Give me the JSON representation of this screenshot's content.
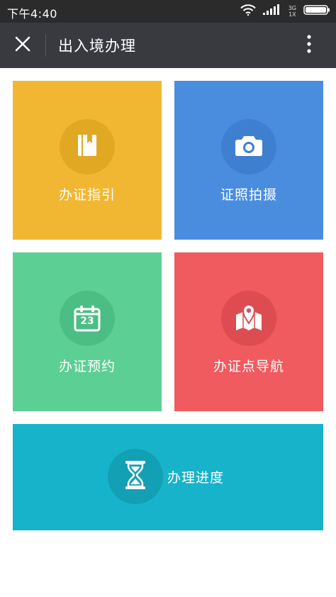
{
  "status_bar": {
    "time": "下午4:40",
    "network_top": "3G",
    "network_bottom": "1X"
  },
  "nav": {
    "title": "出入境办理"
  },
  "tiles": [
    {
      "label": "办证指引",
      "icon": "book-icon",
      "color": "#f2b732"
    },
    {
      "label": "证照拍摄",
      "icon": "camera-icon",
      "color": "#4a8ddf"
    },
    {
      "label": "办证预约",
      "icon": "calendar-icon",
      "color": "#5ccf95",
      "icon_text": "23"
    },
    {
      "label": "办证点导航",
      "icon": "map-pin-icon",
      "color": "#ef5b5f"
    },
    {
      "label": "办理进度",
      "icon": "hourglass-icon",
      "color": "#17b3ca"
    }
  ]
}
